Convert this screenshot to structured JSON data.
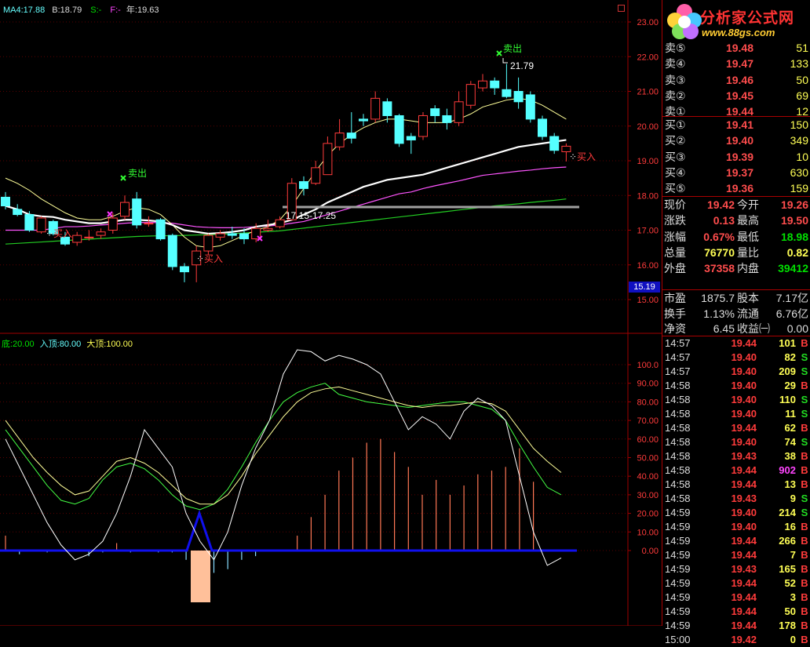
{
  "top_info": {
    "ma4": "MA4:17.88",
    "b": "B:18.79",
    "s": "S:-",
    "f": "F:-",
    "year": "年:19.63"
  },
  "ind_info": {
    "bottom": "底:20.00",
    "entry_top": "入顶:80.00",
    "big_top": "大顶:100.00"
  },
  "price_axis": [
    "23.00",
    "22.00",
    "21.00",
    "20.00",
    "19.00",
    "18.00",
    "17.00",
    "16.00",
    "15.00"
  ],
  "price_marker": "15.19",
  "osc_axis": [
    "100.0",
    "90.00",
    "80.00",
    "70.00",
    "60.00",
    "50.00",
    "40.00",
    "30.00",
    "20.00",
    "10.00",
    "0.00"
  ],
  "annotations": {
    "sell1": "卖出",
    "sell2": "卖出",
    "buy1": "买入",
    "buy2": "买入",
    "buy3": "买入",
    "high_label": "21.79",
    "low_label": "17.15-17.25"
  },
  "logo": {
    "name": "分析家公式网",
    "url": "www.88gs.com"
  },
  "orderbook": {
    "asks": [
      {
        "label": "卖⑤",
        "price": "19.48",
        "vol": "51"
      },
      {
        "label": "卖④",
        "price": "19.47",
        "vol": "133"
      },
      {
        "label": "卖③",
        "price": "19.46",
        "vol": "50"
      },
      {
        "label": "卖②",
        "price": "19.45",
        "vol": "69"
      },
      {
        "label": "卖①",
        "price": "19.44",
        "vol": "12"
      }
    ],
    "bids": [
      {
        "label": "买①",
        "price": "19.41",
        "vol": "150"
      },
      {
        "label": "买②",
        "price": "19.40",
        "vol": "349"
      },
      {
        "label": "买③",
        "price": "19.39",
        "vol": "10"
      },
      {
        "label": "买④",
        "price": "19.37",
        "vol": "630"
      },
      {
        "label": "买⑤",
        "price": "19.36",
        "vol": "159"
      }
    ]
  },
  "quote": {
    "now_l": "现价",
    "now_v": "19.42",
    "open_l": "今开",
    "open_v": "19.26",
    "chg_l": "涨跌",
    "chg_v": "0.13",
    "high_l": "最高",
    "high_v": "19.50",
    "pct_l": "涨幅",
    "pct_v": "0.67%",
    "low_l": "最低",
    "low_v": "18.98",
    "vol_l": "总量",
    "vol_v": "76770",
    "ratio_l": "量比",
    "ratio_v": "0.82",
    "out_l": "外盘",
    "out_v": "37358",
    "in_l": "内盘",
    "in_v": "39412"
  },
  "fund": {
    "pe_l": "市盈",
    "pe_v": "1875.7",
    "cap_l": "股本",
    "cap_v": "7.17亿",
    "turn_l": "换手",
    "turn_v": "1.13%",
    "float_l": "流通",
    "float_v": "6.76亿",
    "nav_l": "净资",
    "nav_v": "6.45",
    "eps_l": "收益㈠",
    "eps_v": "0.00"
  },
  "ticks": [
    {
      "t": "14:57",
      "p": "19.44",
      "q": "101",
      "f": "B"
    },
    {
      "t": "14:57",
      "p": "19.40",
      "q": "82",
      "f": "S"
    },
    {
      "t": "14:57",
      "p": "19.40",
      "q": "209",
      "f": "S"
    },
    {
      "t": "14:58",
      "p": "19.40",
      "q": "29",
      "f": "B"
    },
    {
      "t": "14:58",
      "p": "19.40",
      "q": "110",
      "f": "S"
    },
    {
      "t": "14:58",
      "p": "19.40",
      "q": "11",
      "f": "S"
    },
    {
      "t": "14:58",
      "p": "19.44",
      "q": "62",
      "f": "B"
    },
    {
      "t": "14:58",
      "p": "19.40",
      "q": "74",
      "f": "S"
    },
    {
      "t": "14:58",
      "p": "19.43",
      "q": "38",
      "f": "B"
    },
    {
      "t": "14:58",
      "p": "19.44",
      "q": "902",
      "f": "B"
    },
    {
      "t": "14:58",
      "p": "19.44",
      "q": "13",
      "f": "B"
    },
    {
      "t": "14:58",
      "p": "19.43",
      "q": "9",
      "f": "S"
    },
    {
      "t": "14:59",
      "p": "19.40",
      "q": "214",
      "f": "S"
    },
    {
      "t": "14:59",
      "p": "19.40",
      "q": "16",
      "f": "B"
    },
    {
      "t": "14:59",
      "p": "19.44",
      "q": "266",
      "f": "B"
    },
    {
      "t": "14:59",
      "p": "19.44",
      "q": "7",
      "f": "B"
    },
    {
      "t": "14:59",
      "p": "19.43",
      "q": "165",
      "f": "B"
    },
    {
      "t": "14:59",
      "p": "19.44",
      "q": "52",
      "f": "B"
    },
    {
      "t": "14:59",
      "p": "19.44",
      "q": "3",
      "f": "B"
    },
    {
      "t": "14:59",
      "p": "19.44",
      "q": "50",
      "f": "B"
    },
    {
      "t": "14:59",
      "p": "19.44",
      "q": "178",
      "f": "B"
    },
    {
      "t": "15:00",
      "p": "19.42",
      "q": "0",
      "f": "B"
    }
  ],
  "colors": {
    "up": "#ff3b3b",
    "down": "#55ffff",
    "grid": "#a00000",
    "ma_fast": "#ffffff",
    "ma_mid": "#ffff99",
    "ma_slow": "#ff55ff",
    "ma_long": "#22cc22"
  },
  "chart_data": {
    "type": "candlestick",
    "ylim": [
      15.0,
      23.0
    ],
    "candles": [
      [
        17.95,
        17.7,
        18.1,
        17.6
      ],
      [
        17.6,
        17.45,
        17.75,
        17.4
      ],
      [
        17.45,
        17.0,
        17.55,
        16.95
      ],
      [
        16.95,
        17.35,
        17.4,
        16.9
      ],
      [
        17.25,
        16.9,
        17.3,
        16.85
      ],
      [
        16.8,
        16.6,
        16.95,
        16.55
      ],
      [
        16.65,
        16.85,
        16.95,
        16.55
      ],
      [
        16.8,
        16.8,
        17.0,
        16.7
      ],
      [
        16.85,
        16.95,
        17.05,
        16.75
      ],
      [
        17.0,
        17.35,
        17.5,
        16.9
      ],
      [
        17.4,
        17.8,
        18.0,
        17.3
      ],
      [
        17.9,
        17.15,
        18.1,
        17.05
      ],
      [
        17.2,
        17.2,
        17.4,
        17.1
      ],
      [
        17.3,
        16.75,
        17.35,
        16.7
      ],
      [
        16.85,
        15.95,
        16.9,
        15.85
      ],
      [
        15.95,
        15.8,
        16.05,
        15.5
      ],
      [
        16.0,
        16.4,
        16.55,
        15.5
      ],
      [
        16.4,
        16.85,
        16.9,
        16.3
      ],
      [
        16.8,
        16.9,
        17.0,
        16.7
      ],
      [
        16.9,
        16.85,
        17.1,
        16.75
      ],
      [
        16.9,
        16.75,
        17.05,
        16.6
      ],
      [
        16.75,
        17.05,
        17.2,
        16.65
      ],
      [
        17.0,
        17.05,
        17.3,
        16.95
      ],
      [
        17.1,
        17.3,
        17.4,
        17.05
      ],
      [
        17.3,
        18.35,
        18.5,
        17.3
      ],
      [
        18.4,
        18.2,
        18.55,
        18.0
      ],
      [
        18.35,
        18.8,
        19.0,
        18.3
      ],
      [
        18.6,
        19.5,
        19.7,
        18.6
      ],
      [
        19.4,
        19.8,
        20.2,
        19.3
      ],
      [
        19.8,
        19.65,
        20.4,
        19.5
      ],
      [
        20.2,
        20.15,
        20.35,
        20.0
      ],
      [
        20.2,
        20.8,
        21.0,
        20.1
      ],
      [
        20.7,
        20.3,
        20.8,
        20.1
      ],
      [
        20.3,
        19.5,
        20.35,
        19.4
      ],
      [
        19.7,
        19.6,
        19.8,
        19.2
      ],
      [
        19.7,
        20.3,
        20.4,
        19.6
      ],
      [
        20.5,
        20.3,
        20.6,
        20.1
      ],
      [
        20.3,
        20.1,
        20.5,
        19.9
      ],
      [
        20.1,
        20.7,
        21.0,
        20.0
      ],
      [
        20.6,
        21.2,
        21.3,
        20.5
      ],
      [
        21.1,
        21.3,
        21.5,
        21.0
      ],
      [
        21.3,
        21.1,
        21.4,
        20.9
      ],
      [
        21.05,
        20.85,
        21.79,
        20.8
      ],
      [
        21.0,
        20.7,
        21.4,
        20.5
      ],
      [
        20.9,
        20.2,
        21.0,
        20.1
      ],
      [
        20.2,
        19.7,
        20.3,
        19.6
      ],
      [
        19.7,
        19.3,
        19.8,
        19.2
      ],
      [
        19.26,
        19.42,
        19.5,
        18.98
      ]
    ],
    "ma_fast": [
      17.7,
      17.6,
      17.45,
      17.4,
      17.38,
      17.3,
      17.25,
      17.2,
      17.2,
      17.25,
      17.3,
      17.3,
      17.28,
      17.25,
      17.15,
      17.0,
      16.95,
      16.9,
      16.92,
      16.95,
      17.0,
      17.1,
      17.15,
      17.2,
      17.3,
      17.45,
      17.6,
      17.8,
      17.95,
      18.1,
      18.25,
      18.35,
      18.45,
      18.5,
      18.55,
      18.6,
      18.7,
      18.8,
      18.9,
      19.0,
      19.1,
      19.2,
      19.3,
      19.4,
      19.45,
      19.5,
      19.55,
      19.6
    ],
    "ma_mid": [
      18.0,
      17.85,
      17.6,
      17.45,
      17.3,
      17.15,
      17.0,
      17.0,
      17.05,
      17.2,
      17.35,
      17.4,
      17.35,
      17.2,
      16.9,
      16.6,
      16.4,
      16.4,
      16.5,
      16.6,
      16.7,
      16.85,
      16.95,
      17.1,
      17.4,
      17.8,
      18.2,
      18.6,
      19.0,
      19.35,
      19.6,
      19.85,
      20.0,
      20.05,
      20.05,
      20.1,
      20.2,
      20.25,
      20.35,
      20.5,
      20.65,
      20.75,
      20.8,
      20.85,
      20.7,
      20.5,
      20.2,
      19.9
    ],
    "ma_slow": [
      17.0,
      17.0,
      17.0,
      17.0,
      17.05,
      17.1,
      17.1,
      17.12,
      17.15,
      17.17,
      17.2,
      17.22,
      17.22,
      17.22,
      17.2,
      17.15,
      17.1,
      17.08,
      17.07,
      17.07,
      17.08,
      17.1,
      17.12,
      17.15,
      17.2,
      17.25,
      17.35,
      17.45,
      17.55,
      17.65,
      17.75,
      17.85,
      17.95,
      18.05,
      18.1,
      18.2,
      18.28,
      18.35,
      18.42,
      18.5,
      18.58,
      18.62,
      18.66,
      18.7,
      18.73,
      18.77,
      18.8,
      18.82
    ],
    "ma_long": [
      16.6,
      16.62,
      16.64,
      16.66,
      16.68,
      16.7,
      16.72,
      16.74,
      16.76,
      16.78,
      16.8,
      16.82,
      16.83,
      16.84,
      16.84,
      16.85,
      16.86,
      16.87,
      16.88,
      16.9,
      16.92,
      16.94,
      16.96,
      16.98,
      17.02,
      17.06,
      17.1,
      17.14,
      17.18,
      17.22,
      17.26,
      17.3,
      17.34,
      17.38,
      17.42,
      17.46,
      17.5,
      17.54,
      17.58,
      17.62,
      17.66,
      17.7,
      17.73,
      17.76,
      17.8,
      17.83,
      17.86,
      17.9
    ],
    "ma_yellow": [
      18.5,
      18.35,
      18.15,
      17.9,
      17.7,
      17.5,
      17.35,
      17.3,
      17.3,
      17.4,
      17.55,
      17.65,
      17.6,
      17.45,
      17.15,
      16.8,
      16.55,
      16.5,
      16.55,
      16.7,
      16.85,
      17.0,
      17.1,
      17.3,
      17.7,
      18.2,
      18.7,
      19.15,
      19.5,
      19.75,
      19.95,
      20.1,
      20.2,
      20.2,
      20.15,
      20.1,
      20.1,
      20.1,
      20.2,
      20.35,
      20.55,
      20.65,
      20.75,
      20.8,
      20.75,
      20.6,
      20.4,
      20.2
    ],
    "kd": {
      "white": [
        60,
        45,
        30,
        15,
        3,
        -5,
        -2,
        5,
        20,
        40,
        65,
        55,
        45,
        20,
        5,
        -5,
        10,
        35,
        55,
        70,
        95,
        108,
        107,
        102,
        105,
        103,
        100,
        95,
        80,
        65,
        72,
        68,
        60,
        75,
        82,
        78,
        70,
        40,
        10,
        -8,
        -4
      ],
      "yellow": [
        70,
        60,
        50,
        42,
        35,
        30,
        32,
        40,
        48,
        50,
        47,
        42,
        35,
        28,
        25,
        25,
        30,
        40,
        52,
        62,
        72,
        80,
        85,
        87,
        88,
        86,
        84,
        82,
        80,
        78,
        77,
        78,
        78,
        79,
        80,
        79,
        75,
        65,
        55,
        48,
        42
      ],
      "green": [
        65,
        55,
        45,
        35,
        27,
        25,
        28,
        38,
        45,
        47,
        44,
        38,
        30,
        24,
        22,
        25,
        33,
        45,
        58,
        70,
        80,
        85,
        88,
        90,
        84,
        82,
        80,
        79,
        78,
        77,
        78,
        79,
        80,
        80,
        78,
        76,
        70,
        57,
        45,
        34,
        30
      ]
    },
    "osc_ylim": [
      -15,
      110
    ]
  }
}
